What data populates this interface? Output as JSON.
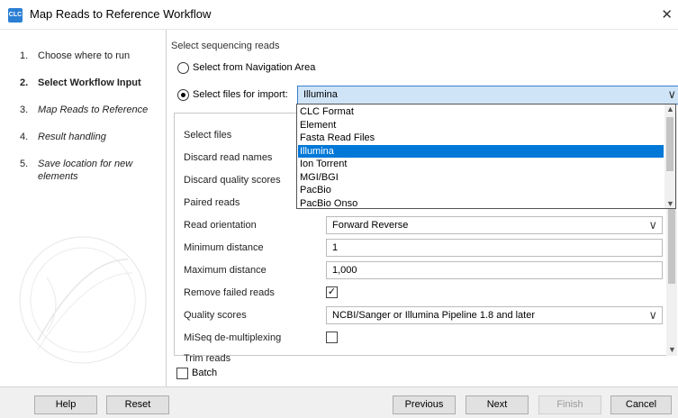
{
  "window": {
    "title": "Map Reads to Reference Workflow",
    "app_icon_text": "CLC",
    "close_glyph": "✕"
  },
  "sidebar": {
    "steps": [
      {
        "num": "1.",
        "label": "Choose where to run"
      },
      {
        "num": "2.",
        "label": "Select Workflow Input"
      },
      {
        "num": "3.",
        "label": "Map Reads to Reference"
      },
      {
        "num": "4.",
        "label": "Result handling"
      },
      {
        "num": "5.",
        "label": "Save location for new elements"
      }
    ]
  },
  "main": {
    "section_title": "Select sequencing reads",
    "radio_navigation": "Select from Navigation Area",
    "radio_import": "Select files for import:",
    "format_value": "Illumina",
    "format_options": [
      "CLC Format",
      "Element",
      "Fasta Read Files",
      "Illumina",
      "Ion Torrent",
      "MGI/BGI",
      "PacBio",
      "PacBio Onso"
    ],
    "selected_option_index": 3,
    "fields": {
      "select_files": "Select files",
      "discard_read_names": "Discard read names",
      "discard_quality_scores": "Discard quality scores",
      "paired_reads": "Paired reads",
      "read_orientation": "Read orientation",
      "read_orientation_value": "Forward Reverse",
      "minimum_distance": "Minimum distance",
      "minimum_distance_value": "1",
      "maximum_distance": "Maximum distance",
      "maximum_distance_value": "1,000",
      "remove_failed_reads": "Remove failed reads",
      "remove_failed_reads_checked": true,
      "quality_scores": "Quality scores",
      "quality_scores_value": "NCBI/Sanger or Illumina Pipeline 1.8 and later",
      "miseq_demultiplexing": "MiSeq de-multiplexing",
      "miseq_checked": false,
      "trim_reads": "Trim reads",
      "trim_reads_checked": false
    },
    "batch_label": "Batch",
    "batch_checked": false
  },
  "footer": {
    "help": "Help",
    "reset": "Reset",
    "previous": "Previous",
    "next": "Next",
    "finish": "Finish",
    "cancel": "Cancel"
  },
  "glyphs": {
    "chevron_down": "∨",
    "check": "✓",
    "arrow_up": "▲",
    "arrow_down": "▼"
  },
  "colors": {
    "selection": "#0078d7",
    "combo_highlight": "#cfe4f7",
    "combo_border": "#3a7fd0"
  }
}
